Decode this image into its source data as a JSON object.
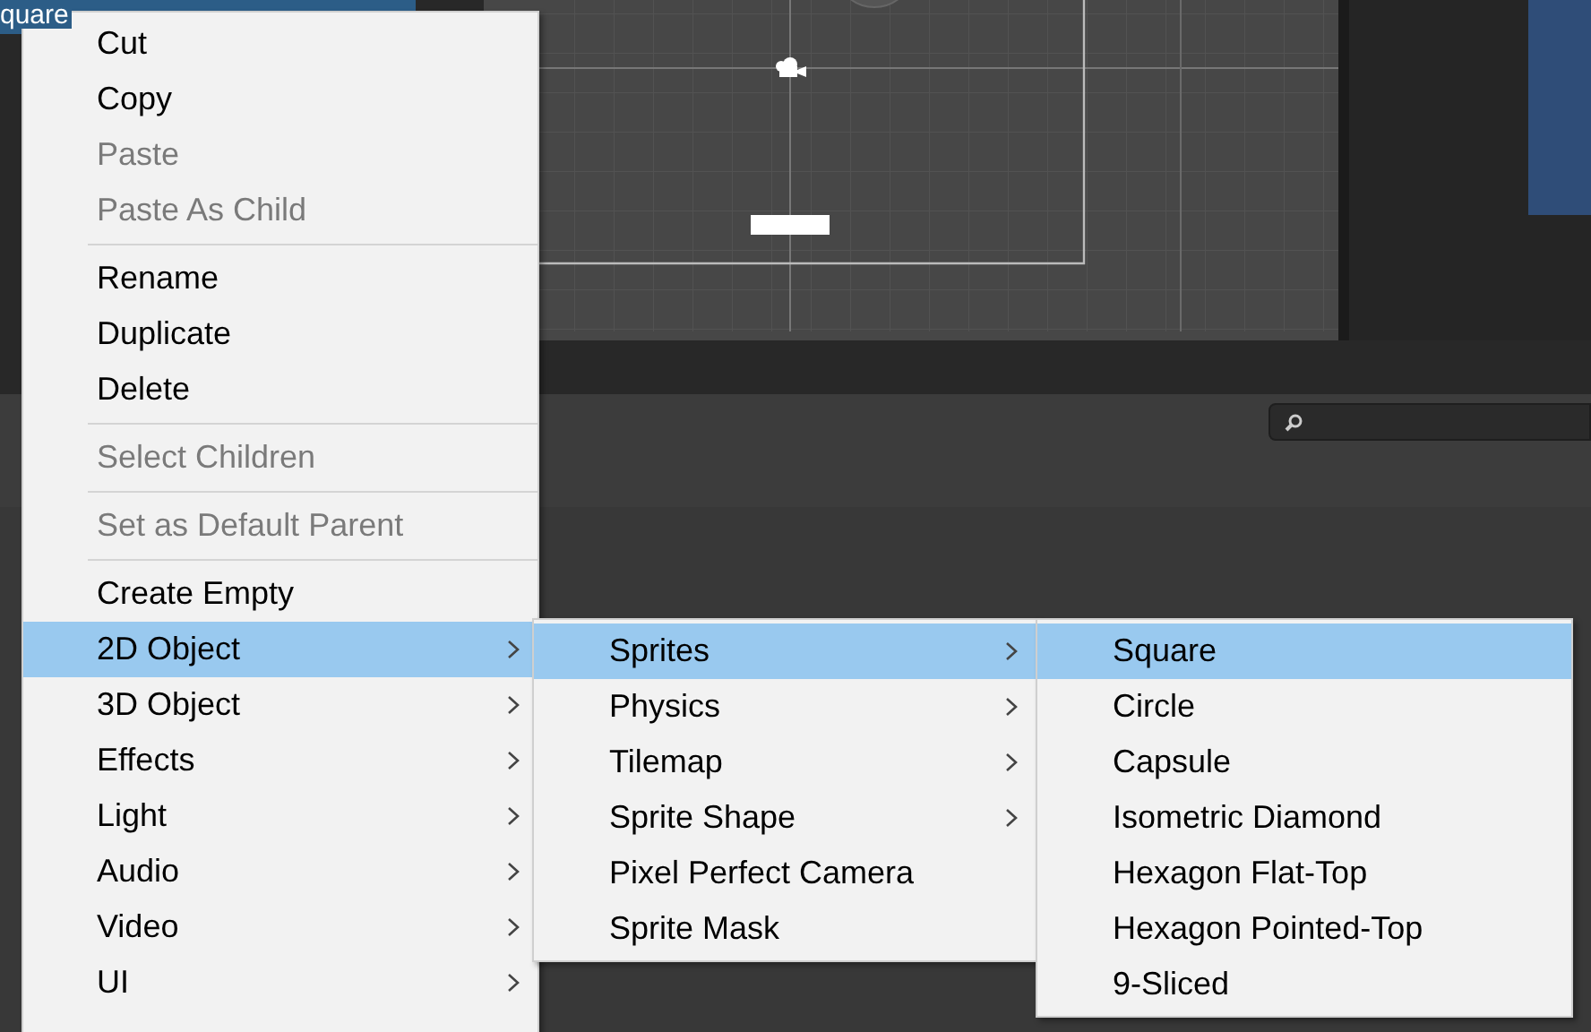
{
  "hierarchy": {
    "selected_item": "quare"
  },
  "context_menu": {
    "items": [
      {
        "kind": "item",
        "label": "Cut",
        "disabled": false,
        "selected": false,
        "submenu": false
      },
      {
        "kind": "item",
        "label": "Copy",
        "disabled": false,
        "selected": false,
        "submenu": false
      },
      {
        "kind": "item",
        "label": "Paste",
        "disabled": true,
        "selected": false,
        "submenu": false
      },
      {
        "kind": "item",
        "label": "Paste As Child",
        "disabled": true,
        "selected": false,
        "submenu": false
      },
      {
        "kind": "separator"
      },
      {
        "kind": "item",
        "label": "Rename",
        "disabled": false,
        "selected": false,
        "submenu": false
      },
      {
        "kind": "item",
        "label": "Duplicate",
        "disabled": false,
        "selected": false,
        "submenu": false
      },
      {
        "kind": "item",
        "label": "Delete",
        "disabled": false,
        "selected": false,
        "submenu": false
      },
      {
        "kind": "separator"
      },
      {
        "kind": "item",
        "label": "Select Children",
        "disabled": true,
        "selected": false,
        "submenu": false
      },
      {
        "kind": "separator"
      },
      {
        "kind": "item",
        "label": "Set as Default Parent",
        "disabled": true,
        "selected": false,
        "submenu": false
      },
      {
        "kind": "separator"
      },
      {
        "kind": "item",
        "label": "Create Empty",
        "disabled": false,
        "selected": false,
        "submenu": false
      },
      {
        "kind": "item",
        "label": "2D Object",
        "disabled": false,
        "selected": true,
        "submenu": true
      },
      {
        "kind": "item",
        "label": "3D Object",
        "disabled": false,
        "selected": false,
        "submenu": true
      },
      {
        "kind": "item",
        "label": "Effects",
        "disabled": false,
        "selected": false,
        "submenu": true
      },
      {
        "kind": "item",
        "label": "Light",
        "disabled": false,
        "selected": false,
        "submenu": true
      },
      {
        "kind": "item",
        "label": "Audio",
        "disabled": false,
        "selected": false,
        "submenu": true
      },
      {
        "kind": "item",
        "label": "Video",
        "disabled": false,
        "selected": false,
        "submenu": true
      },
      {
        "kind": "item",
        "label": "UI",
        "disabled": false,
        "selected": false,
        "submenu": true
      }
    ]
  },
  "submenus": [
    {
      "items": [
        {
          "kind": "item",
          "label": "Sprites",
          "disabled": false,
          "selected": true,
          "submenu": true
        },
        {
          "kind": "item",
          "label": "Physics",
          "disabled": false,
          "selected": false,
          "submenu": true
        },
        {
          "kind": "item",
          "label": "Tilemap",
          "disabled": false,
          "selected": false,
          "submenu": true
        },
        {
          "kind": "item",
          "label": "Sprite Shape",
          "disabled": false,
          "selected": false,
          "submenu": true
        },
        {
          "kind": "item",
          "label": "Pixel Perfect Camera",
          "disabled": false,
          "selected": false,
          "submenu": false
        },
        {
          "kind": "item",
          "label": "Sprite Mask",
          "disabled": false,
          "selected": false,
          "submenu": false
        }
      ]
    },
    {
      "items": [
        {
          "kind": "item",
          "label": "Square",
          "disabled": false,
          "selected": true,
          "submenu": false
        },
        {
          "kind": "item",
          "label": "Circle",
          "disabled": false,
          "selected": false,
          "submenu": false
        },
        {
          "kind": "item",
          "label": "Capsule",
          "disabled": false,
          "selected": false,
          "submenu": false
        },
        {
          "kind": "item",
          "label": "Isometric Diamond",
          "disabled": false,
          "selected": false,
          "submenu": false
        },
        {
          "kind": "item",
          "label": "Hexagon Flat-Top",
          "disabled": false,
          "selected": false,
          "submenu": false
        },
        {
          "kind": "item",
          "label": "Hexagon Pointed-Top",
          "disabled": false,
          "selected": false,
          "submenu": false
        },
        {
          "kind": "item",
          "label": "9-Sliced",
          "disabled": false,
          "selected": false,
          "submenu": false
        }
      ]
    }
  ]
}
